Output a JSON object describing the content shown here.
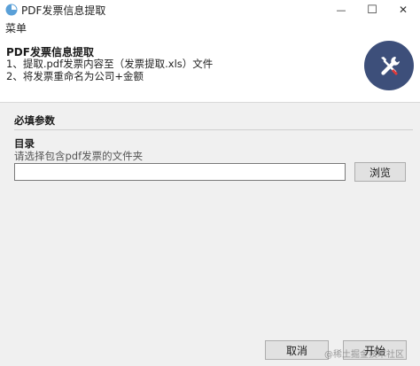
{
  "window": {
    "title": "PDF发票信息提取",
    "minimize_glyph": "—",
    "maximize_glyph": "☐",
    "close_glyph": "✕"
  },
  "menu": {
    "items": [
      {
        "label": "菜单"
      }
    ]
  },
  "header": {
    "title": "PDF发票信息提取",
    "line1": "1、提取.pdf发票内容至（发票提取.xls）文件",
    "line2": "2、将发票重命名为公司+金额",
    "icon": "tools-icon"
  },
  "params": {
    "section_title": "必填参数",
    "dir_label": "目录",
    "dir_hint": "请选择包含pdf发票的文件夹",
    "dir_value": "",
    "browse_label": "浏览"
  },
  "footer": {
    "cancel_label": "取消",
    "start_label": "开始"
  },
  "watermark": "@稀土掘金技术社区",
  "colors": {
    "badge_bg": "#3d4f7a",
    "window_bg": "#f0f0f0"
  }
}
